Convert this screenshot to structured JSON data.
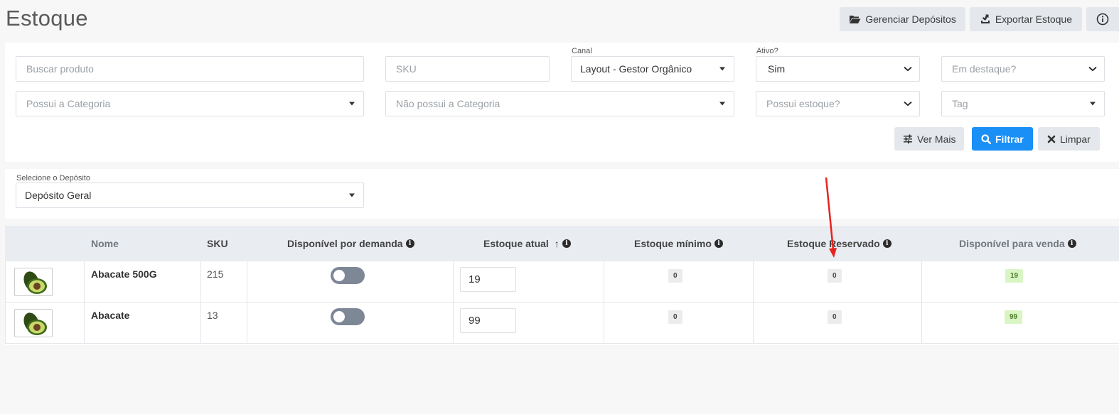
{
  "page": {
    "title": "Estoque"
  },
  "top_actions": {
    "manage_deposits": "Gerenciar Depósitos",
    "export_stock": "Exportar Estoque",
    "info_label": "i"
  },
  "filters": {
    "search_product_placeholder": "Buscar produto",
    "sku_placeholder": "SKU",
    "channel_label": "Canal",
    "channel_value": "Layout - Gestor Orgânico",
    "active_label": "Ativo?",
    "active_value": "Sim",
    "featured_placeholder": "Em destaque?",
    "has_category_placeholder": "Possui a Categoria",
    "not_has_category_placeholder": "Não possui a Categoria",
    "has_stock_placeholder": "Possui estoque?",
    "tag_placeholder": "Tag",
    "see_more": "Ver Mais",
    "filter": "Filtrar",
    "clear": "Limpar"
  },
  "deposit": {
    "label": "Selecione o Depósito",
    "value": "Depósito Geral"
  },
  "table": {
    "columns": {
      "name": "Nome",
      "sku": "SKU",
      "on_demand": "Disponível por demanda",
      "current_stock": "Estoque atual",
      "sort_arrow": "↑",
      "min_stock": "Estoque mínimo",
      "reserved_stock": "Estoque Reservado",
      "available": "Disponível para venda"
    },
    "rows": [
      {
        "name": "Abacate 500G",
        "sku": "215",
        "on_demand": false,
        "current_stock": "19",
        "min_stock": "0",
        "reserved_stock": "0",
        "available": "19"
      },
      {
        "name": "Abacate",
        "sku": "13",
        "on_demand": false,
        "current_stock": "99",
        "min_stock": "0",
        "reserved_stock": "0",
        "available": "99"
      }
    ]
  },
  "colors": {
    "primary_button": "#1a8ff5",
    "annotation_arrow": "#e8231f",
    "available_badge": "#d9f5c4"
  }
}
